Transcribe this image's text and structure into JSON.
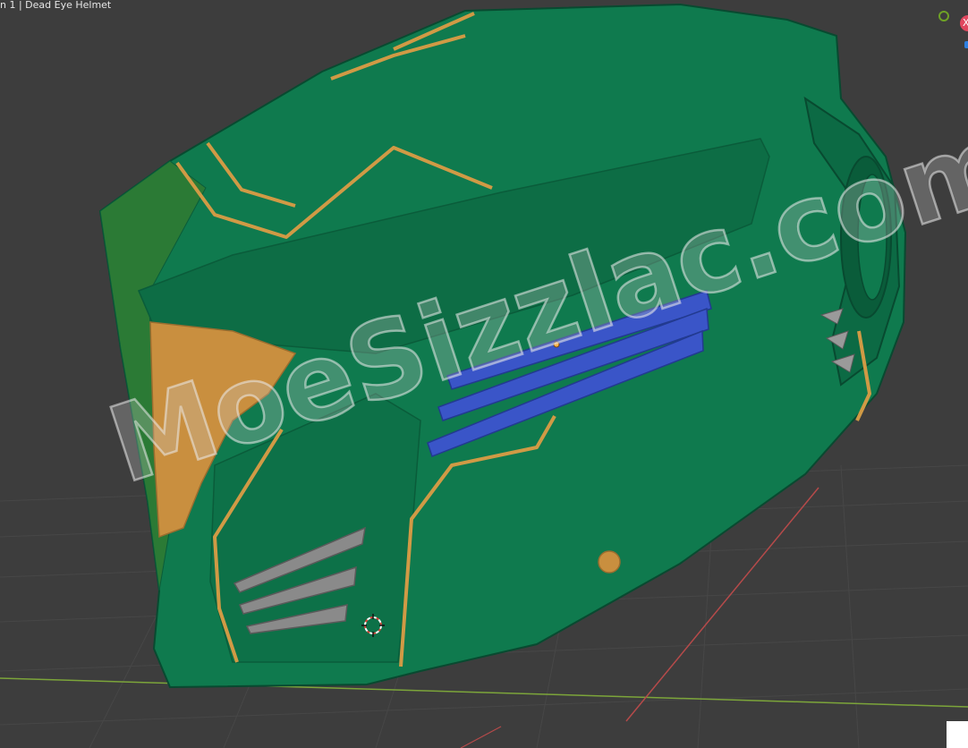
{
  "viewport": {
    "label": "n 1 | Dead Eye Helmet",
    "watermark_text": "MoeSizzlac.com",
    "gizmo_red_label": "X"
  },
  "colors": {
    "background": "#3d3d3d",
    "grid_line": "#474747",
    "x_axis": "#b54a4a",
    "y_axis": "#7ca53a",
    "helmet_green": "#0f7a4e",
    "helmet_green_dark": "#0a5c3a",
    "trim_gold": "#d09a45",
    "vent_blue": "#3a55c8",
    "vent_grey": "#8a8a8a"
  },
  "icons": [
    "3d-cursor-icon",
    "origin-dot-icon",
    "gizmo-x-icon",
    "gizmo-y-icon",
    "gizmo-z-icon"
  ]
}
